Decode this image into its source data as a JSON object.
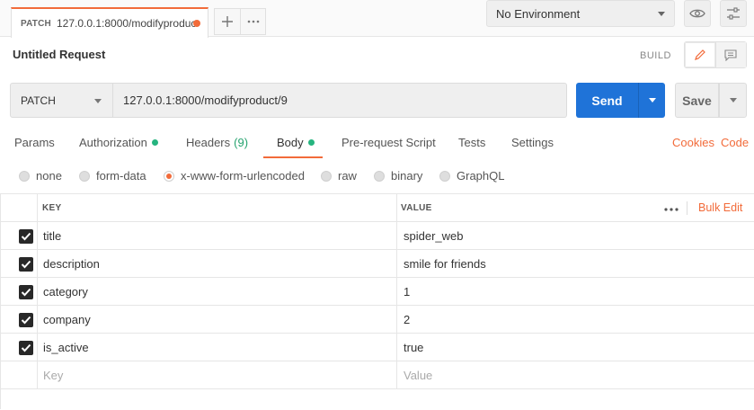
{
  "tab": {
    "method": "PATCH",
    "url": "127.0.0.1:8000/modifyproduc"
  },
  "environment": {
    "selected": "No Environment"
  },
  "request": {
    "title": "Untitled Request",
    "mode_label": "BUILD",
    "method": "PATCH",
    "url": "127.0.0.1:8000/modifyproduct/9",
    "send_label": "Send",
    "save_label": "Save"
  },
  "request_tabs": {
    "params": "Params",
    "authorization": "Authorization",
    "headers": "Headers",
    "headers_count": "(9)",
    "body": "Body",
    "prerequest": "Pre-request Script",
    "tests": "Tests",
    "settings": "Settings",
    "cookies": "Cookies",
    "code": "Code"
  },
  "body_types": {
    "none": "none",
    "form_data": "form-data",
    "urlencoded": "x-www-form-urlencoded",
    "raw": "raw",
    "binary": "binary",
    "graphql": "GraphQL",
    "selected": "x-www-form-urlencoded"
  },
  "table": {
    "key_header": "KEY",
    "value_header": "VALUE",
    "bulk_edit": "Bulk Edit",
    "rows": [
      {
        "key": "title",
        "value": "spider_web",
        "checked": true
      },
      {
        "key": "description",
        "value": "smile for friends",
        "checked": true
      },
      {
        "key": "category",
        "value": "1",
        "checked": true
      },
      {
        "key": "company",
        "value": "2",
        "checked": true
      },
      {
        "key": "is_active",
        "value": "true",
        "checked": true
      }
    ],
    "key_placeholder": "Key",
    "value_placeholder": "Value"
  },
  "colors": {
    "accent": "#f26b3a",
    "primary": "#1f73d8",
    "status_green": "#26b47f"
  }
}
